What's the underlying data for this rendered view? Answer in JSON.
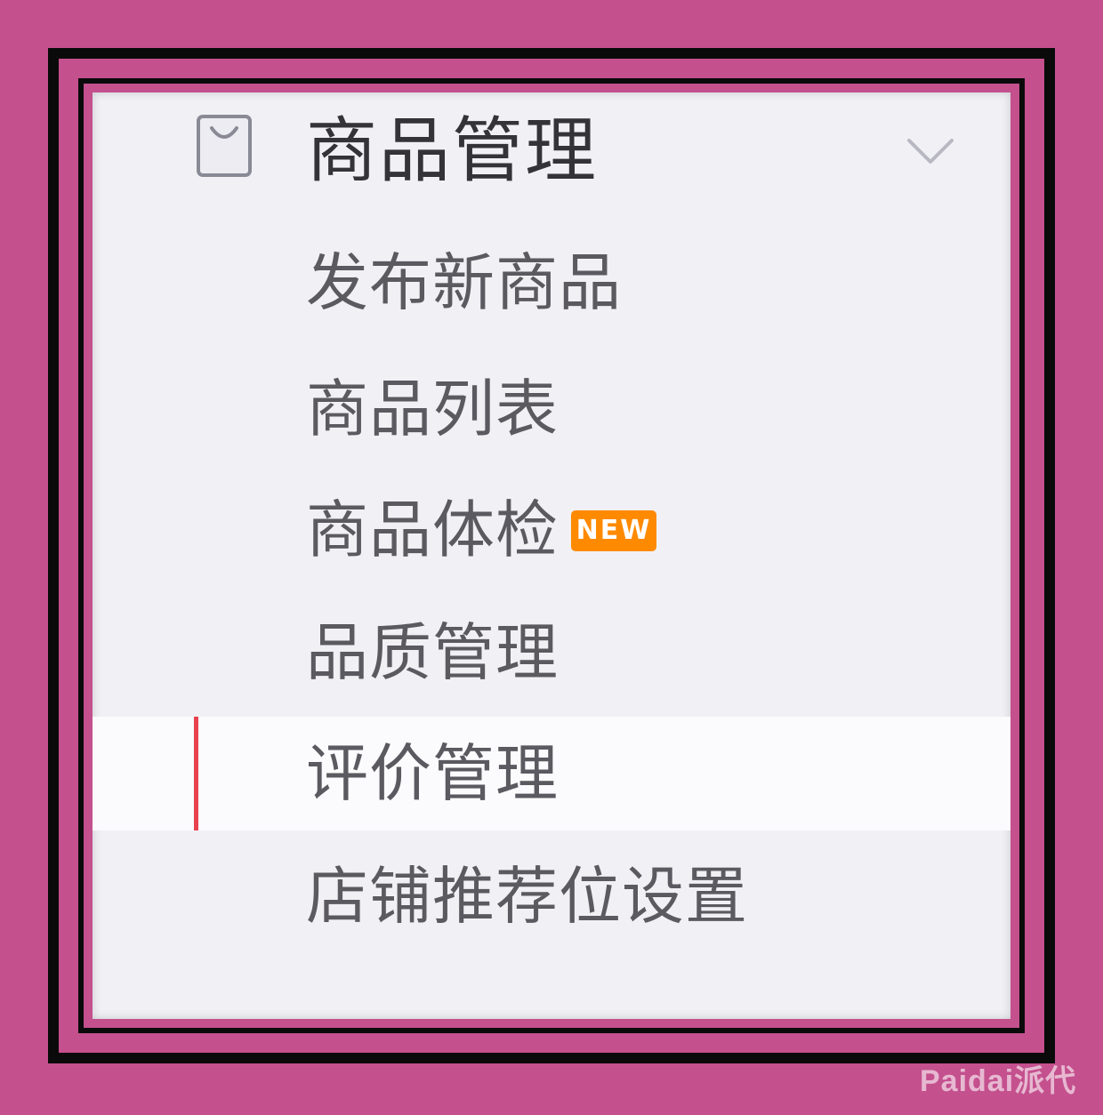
{
  "header": {
    "title": "商品管理",
    "icon": "shopping-bag-icon",
    "toggle_icon": "chevron-down-icon",
    "icon_color": "#8a8a96"
  },
  "menu": {
    "items": [
      {
        "label": "发布新商品"
      },
      {
        "label": "商品列表"
      },
      {
        "label": "商品体检",
        "badge": "NEW"
      },
      {
        "label": "品质管理"
      },
      {
        "label": "评价管理",
        "active": true
      },
      {
        "label": "店铺推荐位设置"
      }
    ]
  },
  "colors": {
    "background": "#c4508e",
    "panel": "#f1f1f5",
    "active_background": "#fbfbfd",
    "active_indicator": "#e8414f",
    "badge": "#ff8a00",
    "text": "#5a5a60",
    "header_text": "#333338"
  },
  "watermark": {
    "text": "Paidai派代"
  }
}
